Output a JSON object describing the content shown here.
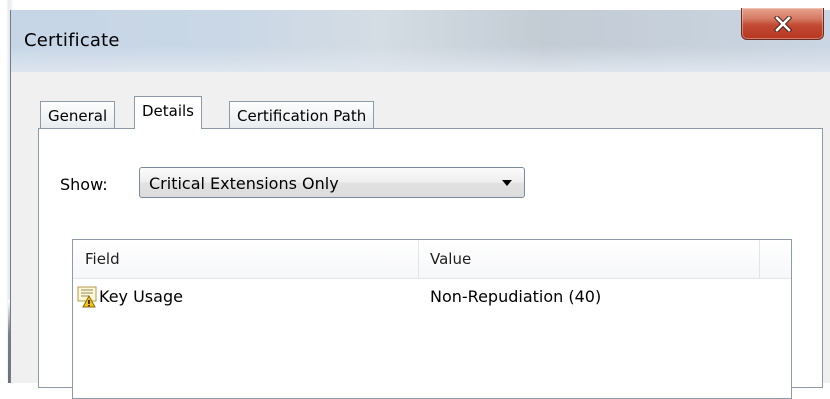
{
  "window": {
    "title": "Certificate",
    "close_icon": "close-icon"
  },
  "tabs": [
    {
      "label": "General",
      "active": false
    },
    {
      "label": "Details",
      "active": true
    },
    {
      "label": "Certification Path",
      "active": false
    }
  ],
  "details": {
    "show_label": "Show:",
    "show_selected": "Critical Extensions Only",
    "columns": [
      "Field",
      "Value"
    ],
    "rows": [
      {
        "icon": "certificate-warning-icon",
        "field": "Key Usage",
        "value": "Non-Repudiation (40)"
      }
    ]
  },
  "colors": {
    "titlebar": "#c9d7e6",
    "close_button": "#c24a33",
    "tab_border": "#8e9aa6",
    "dialog_bg": "#f0f0f0"
  }
}
